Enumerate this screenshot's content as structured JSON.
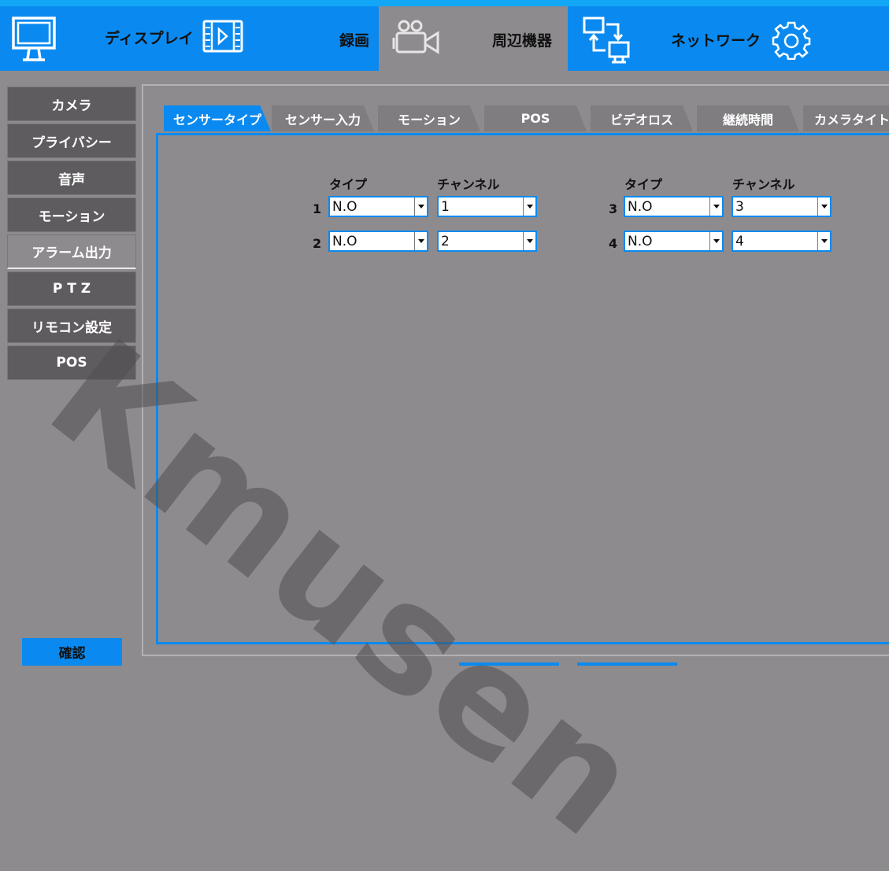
{
  "top_nav": {
    "display_label": "ディスプレイ",
    "record_label": "録画",
    "peripherals_label": "周辺機器",
    "network_label": "ネットワーク"
  },
  "sidebar": {
    "items": [
      {
        "label": "カメラ"
      },
      {
        "label": "プライバシー"
      },
      {
        "label": "音声"
      },
      {
        "label": "モーション"
      },
      {
        "label": "アラーム出力"
      },
      {
        "label": "P T Z"
      },
      {
        "label": "リモコン設定"
      },
      {
        "label": "POS"
      }
    ],
    "active_index": 4,
    "confirm_label": "確認"
  },
  "tabs": [
    {
      "label": "センサータイプ"
    },
    {
      "label": "センサー入力"
    },
    {
      "label": "モーション"
    },
    {
      "label": "POS"
    },
    {
      "label": "ビデオロス"
    },
    {
      "label": "継続時間"
    },
    {
      "label": "カメラタイトル"
    }
  ],
  "active_tab": 0,
  "sensor_table": {
    "type_header": "タイプ",
    "channel_header": "チャンネル",
    "rows": [
      {
        "num": "1",
        "type": "N.O",
        "channel": "1"
      },
      {
        "num": "2",
        "type": "N.O",
        "channel": "2"
      },
      {
        "num": "3",
        "type": "N.O",
        "channel": "3"
      },
      {
        "num": "4",
        "type": "N.O",
        "channel": "4"
      }
    ]
  },
  "watermark": "Kmusen",
  "colors": {
    "accent": "#0a8af0",
    "background": "#8e8b8e",
    "sidebar_button": "#5f5c5f"
  }
}
